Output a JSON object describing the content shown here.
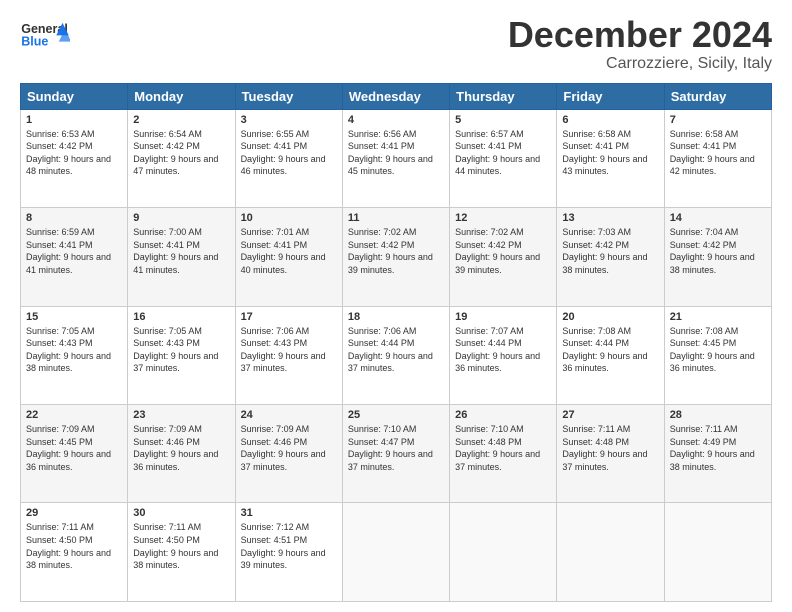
{
  "header": {
    "logo_line1": "General",
    "logo_line2": "Blue",
    "month": "December 2024",
    "location": "Carrozziere, Sicily, Italy"
  },
  "weekdays": [
    "Sunday",
    "Monday",
    "Tuesday",
    "Wednesday",
    "Thursday",
    "Friday",
    "Saturday"
  ],
  "weeks": [
    [
      {
        "day": "1",
        "sunrise": "6:53 AM",
        "sunset": "4:42 PM",
        "daylight": "9 hours and 48 minutes."
      },
      {
        "day": "2",
        "sunrise": "6:54 AM",
        "sunset": "4:42 PM",
        "daylight": "9 hours and 47 minutes."
      },
      {
        "day": "3",
        "sunrise": "6:55 AM",
        "sunset": "4:41 PM",
        "daylight": "9 hours and 46 minutes."
      },
      {
        "day": "4",
        "sunrise": "6:56 AM",
        "sunset": "4:41 PM",
        "daylight": "9 hours and 45 minutes."
      },
      {
        "day": "5",
        "sunrise": "6:57 AM",
        "sunset": "4:41 PM",
        "daylight": "9 hours and 44 minutes."
      },
      {
        "day": "6",
        "sunrise": "6:58 AM",
        "sunset": "4:41 PM",
        "daylight": "9 hours and 43 minutes."
      },
      {
        "day": "7",
        "sunrise": "6:58 AM",
        "sunset": "4:41 PM",
        "daylight": "9 hours and 42 minutes."
      }
    ],
    [
      {
        "day": "8",
        "sunrise": "6:59 AM",
        "sunset": "4:41 PM",
        "daylight": "9 hours and 41 minutes."
      },
      {
        "day": "9",
        "sunrise": "7:00 AM",
        "sunset": "4:41 PM",
        "daylight": "9 hours and 41 minutes."
      },
      {
        "day": "10",
        "sunrise": "7:01 AM",
        "sunset": "4:41 PM",
        "daylight": "9 hours and 40 minutes."
      },
      {
        "day": "11",
        "sunrise": "7:02 AM",
        "sunset": "4:42 PM",
        "daylight": "9 hours and 39 minutes."
      },
      {
        "day": "12",
        "sunrise": "7:02 AM",
        "sunset": "4:42 PM",
        "daylight": "9 hours and 39 minutes."
      },
      {
        "day": "13",
        "sunrise": "7:03 AM",
        "sunset": "4:42 PM",
        "daylight": "9 hours and 38 minutes."
      },
      {
        "day": "14",
        "sunrise": "7:04 AM",
        "sunset": "4:42 PM",
        "daylight": "9 hours and 38 minutes."
      }
    ],
    [
      {
        "day": "15",
        "sunrise": "7:05 AM",
        "sunset": "4:43 PM",
        "daylight": "9 hours and 38 minutes."
      },
      {
        "day": "16",
        "sunrise": "7:05 AM",
        "sunset": "4:43 PM",
        "daylight": "9 hours and 37 minutes."
      },
      {
        "day": "17",
        "sunrise": "7:06 AM",
        "sunset": "4:43 PM",
        "daylight": "9 hours and 37 minutes."
      },
      {
        "day": "18",
        "sunrise": "7:06 AM",
        "sunset": "4:44 PM",
        "daylight": "9 hours and 37 minutes."
      },
      {
        "day": "19",
        "sunrise": "7:07 AM",
        "sunset": "4:44 PM",
        "daylight": "9 hours and 36 minutes."
      },
      {
        "day": "20",
        "sunrise": "7:08 AM",
        "sunset": "4:44 PM",
        "daylight": "9 hours and 36 minutes."
      },
      {
        "day": "21",
        "sunrise": "7:08 AM",
        "sunset": "4:45 PM",
        "daylight": "9 hours and 36 minutes."
      }
    ],
    [
      {
        "day": "22",
        "sunrise": "7:09 AM",
        "sunset": "4:45 PM",
        "daylight": "9 hours and 36 minutes."
      },
      {
        "day": "23",
        "sunrise": "7:09 AM",
        "sunset": "4:46 PM",
        "daylight": "9 hours and 36 minutes."
      },
      {
        "day": "24",
        "sunrise": "7:09 AM",
        "sunset": "4:46 PM",
        "daylight": "9 hours and 37 minutes."
      },
      {
        "day": "25",
        "sunrise": "7:10 AM",
        "sunset": "4:47 PM",
        "daylight": "9 hours and 37 minutes."
      },
      {
        "day": "26",
        "sunrise": "7:10 AM",
        "sunset": "4:48 PM",
        "daylight": "9 hours and 37 minutes."
      },
      {
        "day": "27",
        "sunrise": "7:11 AM",
        "sunset": "4:48 PM",
        "daylight": "9 hours and 37 minutes."
      },
      {
        "day": "28",
        "sunrise": "7:11 AM",
        "sunset": "4:49 PM",
        "daylight": "9 hours and 38 minutes."
      }
    ],
    [
      {
        "day": "29",
        "sunrise": "7:11 AM",
        "sunset": "4:50 PM",
        "daylight": "9 hours and 38 minutes."
      },
      {
        "day": "30",
        "sunrise": "7:11 AM",
        "sunset": "4:50 PM",
        "daylight": "9 hours and 38 minutes."
      },
      {
        "day": "31",
        "sunrise": "7:12 AM",
        "sunset": "4:51 PM",
        "daylight": "9 hours and 39 minutes."
      },
      null,
      null,
      null,
      null
    ]
  ]
}
